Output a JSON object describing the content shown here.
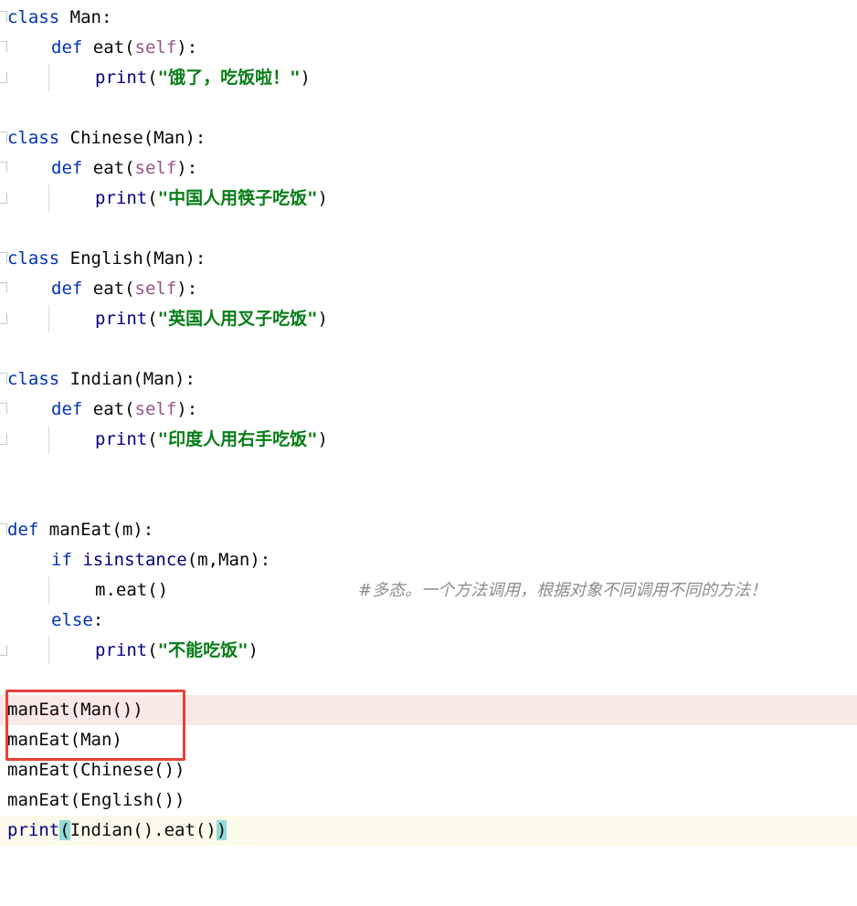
{
  "code": {
    "l1": {
      "kw": "class",
      "rest": " Man:"
    },
    "l2": {
      "kw": "def",
      "fn": " eat(",
      "self": "self",
      "end": "):"
    },
    "l3": {
      "bi": "print",
      "open": "(",
      "str": "\"饿了，吃饭啦！\"",
      "close": ")"
    },
    "l5": {
      "kw": "class",
      "rest": " Chinese(Man):"
    },
    "l6": {
      "kw": "def",
      "fn": " eat(",
      "self": "self",
      "end": "):"
    },
    "l7": {
      "bi": "print",
      "open": "(",
      "str": "\"中国人用筷子吃饭\"",
      "close": ")"
    },
    "l9": {
      "kw": "class",
      "rest": " English(Man):"
    },
    "l10": {
      "kw": "def",
      "fn": " eat(",
      "self": "self",
      "end": "):"
    },
    "l11": {
      "bi": "print",
      "open": "(",
      "str": "\"英国人用叉子吃饭\"",
      "close": ")"
    },
    "l13": {
      "kw": "class",
      "rest": " Indian(Man):"
    },
    "l14": {
      "kw": "def",
      "fn": " eat(",
      "self": "self",
      "end": "):"
    },
    "l15": {
      "bi": "print",
      "open": "(",
      "str": "\"印度人用右手吃饭\"",
      "close": ")"
    },
    "l18": {
      "kw": "def",
      "rest": " manEat(m):"
    },
    "l19": {
      "kw": "if",
      "bi": " isinstance",
      "rest": "(m,Man):"
    },
    "l20": {
      "rest": "m.eat()",
      "comment": "#多态。一个方法调用，根据对象不同调用不同的方法！"
    },
    "l21": {
      "kw": "else",
      "rest": ":"
    },
    "l22": {
      "bi": "print",
      "open": "(",
      "str": "\"不能吃饭\"",
      "close": ")"
    },
    "l24": {
      "rest": "manEat(Man())"
    },
    "l25": {
      "rest": "manEat(Man)"
    },
    "l26": {
      "rest": "manEat(Chinese())"
    },
    "l27": {
      "rest": "manEat(English())"
    },
    "l28": {
      "bi": "print",
      "open": "(",
      "mid": "Indian().eat()",
      "close": ")"
    }
  },
  "colors": {
    "keyword": "#0033b3",
    "self": "#94558d",
    "builtin": "#000080",
    "string": "#067d17",
    "comment": "#8c8c8c",
    "error_line_bg": "#f8e8e6",
    "caret_line_bg": "#fcfbeb",
    "brace_match": "#93d9d9",
    "annotation_box": "#e8403a"
  }
}
